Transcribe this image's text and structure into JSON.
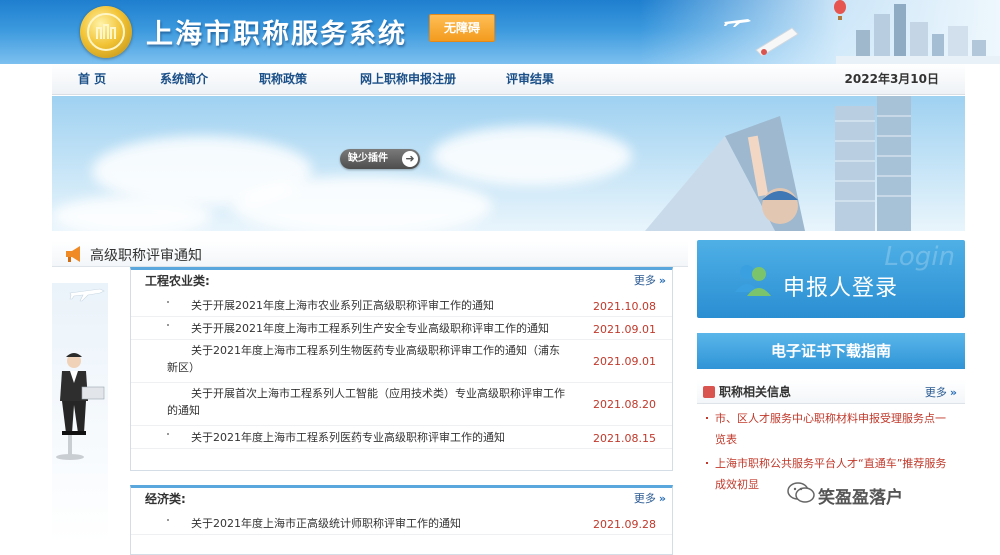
{
  "header": {
    "site_title": "上海市职称服务系统",
    "accessibility_label": "无障碍"
  },
  "nav": {
    "items": [
      "首 页",
      "系统简介",
      "职称政策",
      "网上职称申报注册",
      "评审结果"
    ],
    "date": "2022年3月10日"
  },
  "banner": {
    "plugin_button": "缺少插件"
  },
  "main": {
    "section_title": "高级职称评审通知",
    "panels": [
      {
        "title": "工程农业类:",
        "more": "更多",
        "notices": [
          {
            "text": "关于开展2021年度上海市农业系列正高级职称评审工作的通知",
            "date": "2021.10.08"
          },
          {
            "text": "关于开展2021年度上海市工程系列生产安全专业高级职称评审工作的通知",
            "date": "2021.09.01"
          },
          {
            "text": "关于2021年度上海市工程系列生物医药专业高级职称评审工作的通知（浦东新区）",
            "date": "2021.09.01"
          },
          {
            "text": "关于开展首次上海市工程系列人工智能（应用技术类）专业高级职称评审工作的通知",
            "date": "2021.08.20"
          },
          {
            "text": "关于2021年度上海市工程系列医药专业高级职称评审工作的通知",
            "date": "2021.08.15"
          }
        ]
      },
      {
        "title": "经济类:",
        "more": "更多",
        "notices": [
          {
            "text": "关于2021年度上海市正高级统计师职称评审工作的通知",
            "date": "2021.09.28"
          }
        ]
      }
    ]
  },
  "sidebar": {
    "login_watermark": "Login",
    "login_label": "申报人登录",
    "cert_guide": "电子证书下载指南",
    "info_title": "职称相关信息",
    "info_more": "更多",
    "info_items": [
      "市、区人才服务中心职称材料申报受理服务点一览表",
      "上海市职称公共服务平台人才“直通车”推荐服务成效初显"
    ]
  },
  "watermark": {
    "wechat_text": "笑盈盈落户"
  },
  "icons": {
    "logo": "shanghai-emblem-logo",
    "more_arrow": "double-chevron-right-icon",
    "speaker": "megaphone-icon",
    "login": "users-icon",
    "wechat": "wechat-icon"
  },
  "colors": {
    "header_blue": "#2a8ed2",
    "accent_orange": "#f39b1e",
    "nav_text": "#1a4f88",
    "date_red": "#c0392b",
    "panel_border_top": "#5aa7dd"
  }
}
